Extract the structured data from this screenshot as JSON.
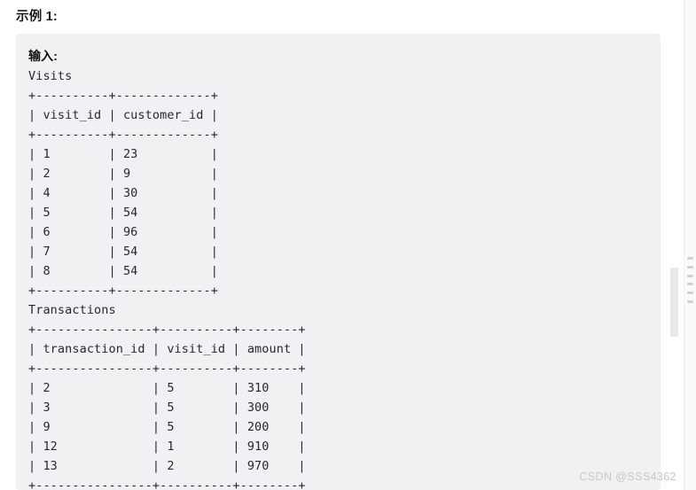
{
  "page": {
    "title": "示例 1:",
    "background_color": "#ffffff"
  },
  "code_block": {
    "background_color": "#f0f1f3",
    "input_label": "输入:",
    "lines": [
      "Visits",
      "+----------+-------------+",
      "| visit_id | customer_id |",
      "+----------+-------------+",
      "| 1        | 23          |",
      "| 2        | 9           |",
      "| 4        | 30          |",
      "| 5        | 54          |",
      "| 6        | 96          |",
      "| 7        | 54          |",
      "| 8        | 54          |",
      "+----------+-------------+",
      "Transactions",
      "+----------------+----------+--------+",
      "| transaction_id | visit_id | amount |",
      "+----------------+----------+--------+",
      "| 2              | 5        | 310    |",
      "| 3              | 5        | 300    |",
      "| 9              | 5        | 200    |",
      "| 12             | 1        | 910    |",
      "| 13             | 2        | 970    |",
      "+----------------+----------+--------+"
    ],
    "tables": [
      {
        "name": "Visits",
        "columns": [
          "visit_id",
          "customer_id"
        ],
        "rows": [
          [
            "1",
            "23"
          ],
          [
            "2",
            "9"
          ],
          [
            "4",
            "30"
          ],
          [
            "5",
            "54"
          ],
          [
            "6",
            "96"
          ],
          [
            "7",
            "54"
          ],
          [
            "8",
            "54"
          ]
        ]
      },
      {
        "name": "Transactions",
        "columns": [
          "transaction_id",
          "visit_id",
          "amount"
        ],
        "rows": [
          [
            "2",
            "5",
            "310"
          ],
          [
            "3",
            "5",
            "300"
          ],
          [
            "9",
            "5",
            "200"
          ],
          [
            "12",
            "1",
            "910"
          ],
          [
            "13",
            "2",
            "970"
          ]
        ]
      }
    ]
  },
  "scrollbar": {
    "track_color": "#fafafa",
    "grip_color": "#d3d3d3"
  },
  "watermark": {
    "text": "CSDN @SSS4362",
    "color": "#c8c8c8"
  }
}
